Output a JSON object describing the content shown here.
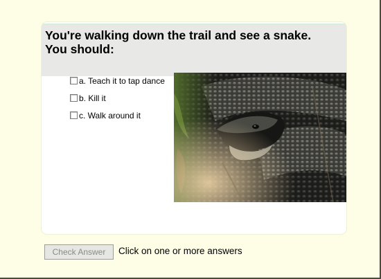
{
  "question": {
    "text": "You're walking down the trail and see a snake.\nYou should:"
  },
  "options": [
    {
      "label": "a. Teach it to tap dance",
      "checked": false
    },
    {
      "label": "b. Kill it",
      "checked": false
    },
    {
      "label": "c. Walk around it",
      "checked": false
    }
  ],
  "image": {
    "icon": "snake-photo"
  },
  "footer": {
    "button_label": "Check Answer",
    "button_enabled": false,
    "hint": "Click on one or more answers"
  },
  "colors": {
    "page_background": "#fefee6",
    "card_background": "#ffffff",
    "question_background": "#e8e8e6",
    "button_text_disabled": "#8a8a8a"
  }
}
